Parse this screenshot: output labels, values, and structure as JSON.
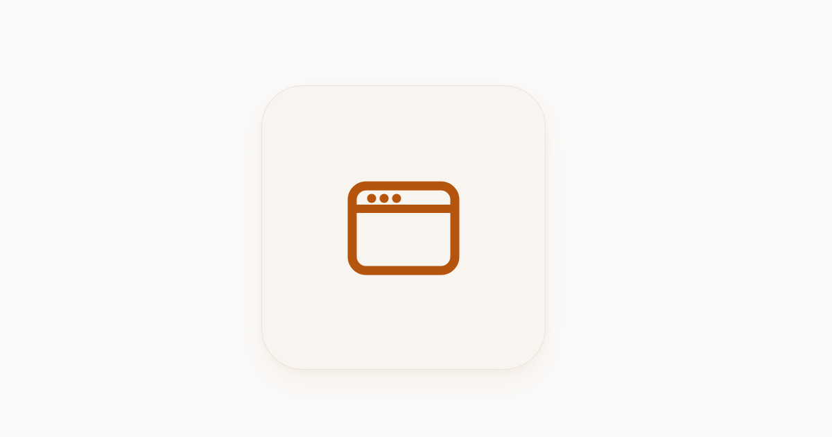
{
  "icon": {
    "name": "browser-window-icon",
    "accent_color": "#b5550d"
  },
  "colors": {
    "background": "#fbfaf9",
    "tile": "#f8f4ef",
    "tile_border": "#ece3da"
  }
}
